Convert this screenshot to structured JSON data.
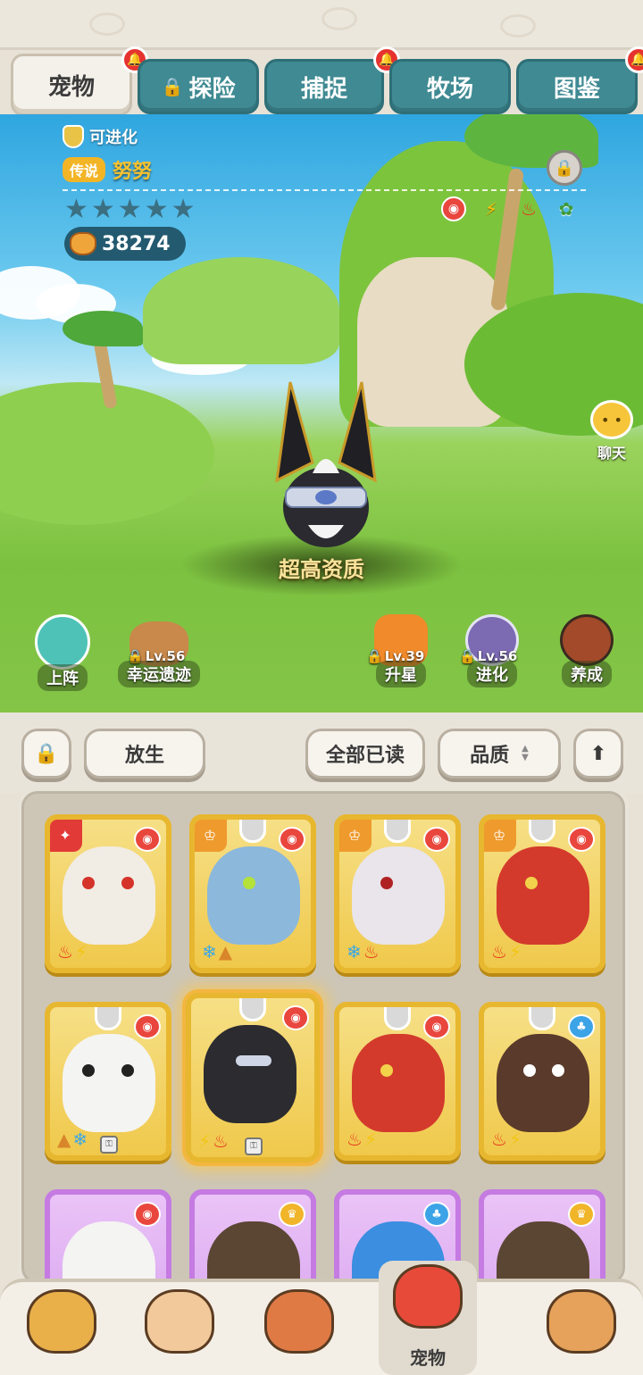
{
  "tabs": [
    {
      "label": "宠物",
      "active": true,
      "locked": false,
      "bell": true
    },
    {
      "label": "探险",
      "active": false,
      "locked": true,
      "bell": false
    },
    {
      "label": "捕捉",
      "active": false,
      "locked": false,
      "bell": true
    },
    {
      "label": "牧场",
      "active": false,
      "locked": false,
      "bell": false
    },
    {
      "label": "图鉴",
      "active": false,
      "locked": false,
      "bell": true
    }
  ],
  "pet": {
    "evolve_label": "可进化",
    "rarity": "传说",
    "name": "努努",
    "stars_filled": 0,
    "stars_total": 5,
    "power": "38274",
    "quality_label": "超高资质",
    "types": [
      "paw-icon",
      "bolt-icon",
      "fire-icon",
      "leaf-icon"
    ]
  },
  "chat": {
    "label": "聊天"
  },
  "actions": {
    "deploy": {
      "label": "上阵"
    },
    "ruins": {
      "label": "幸运遗迹",
      "level": "Lv.56"
    },
    "star_up": {
      "label": "升星",
      "level": "Lv.39"
    },
    "evolve": {
      "label": "进化",
      "level": "Lv.56"
    },
    "train": {
      "label": "养成"
    }
  },
  "toolbar": {
    "release_label": "放生",
    "read_all_label": "全部已读",
    "sort_label": "品质"
  },
  "bottom_nav": {
    "active_label": "宠物"
  },
  "colors": {
    "tab_teal": "#3f8a93",
    "gold_card": "#e7b72f",
    "purple_card": "#c57be2",
    "bell_red": "#e6332f"
  }
}
